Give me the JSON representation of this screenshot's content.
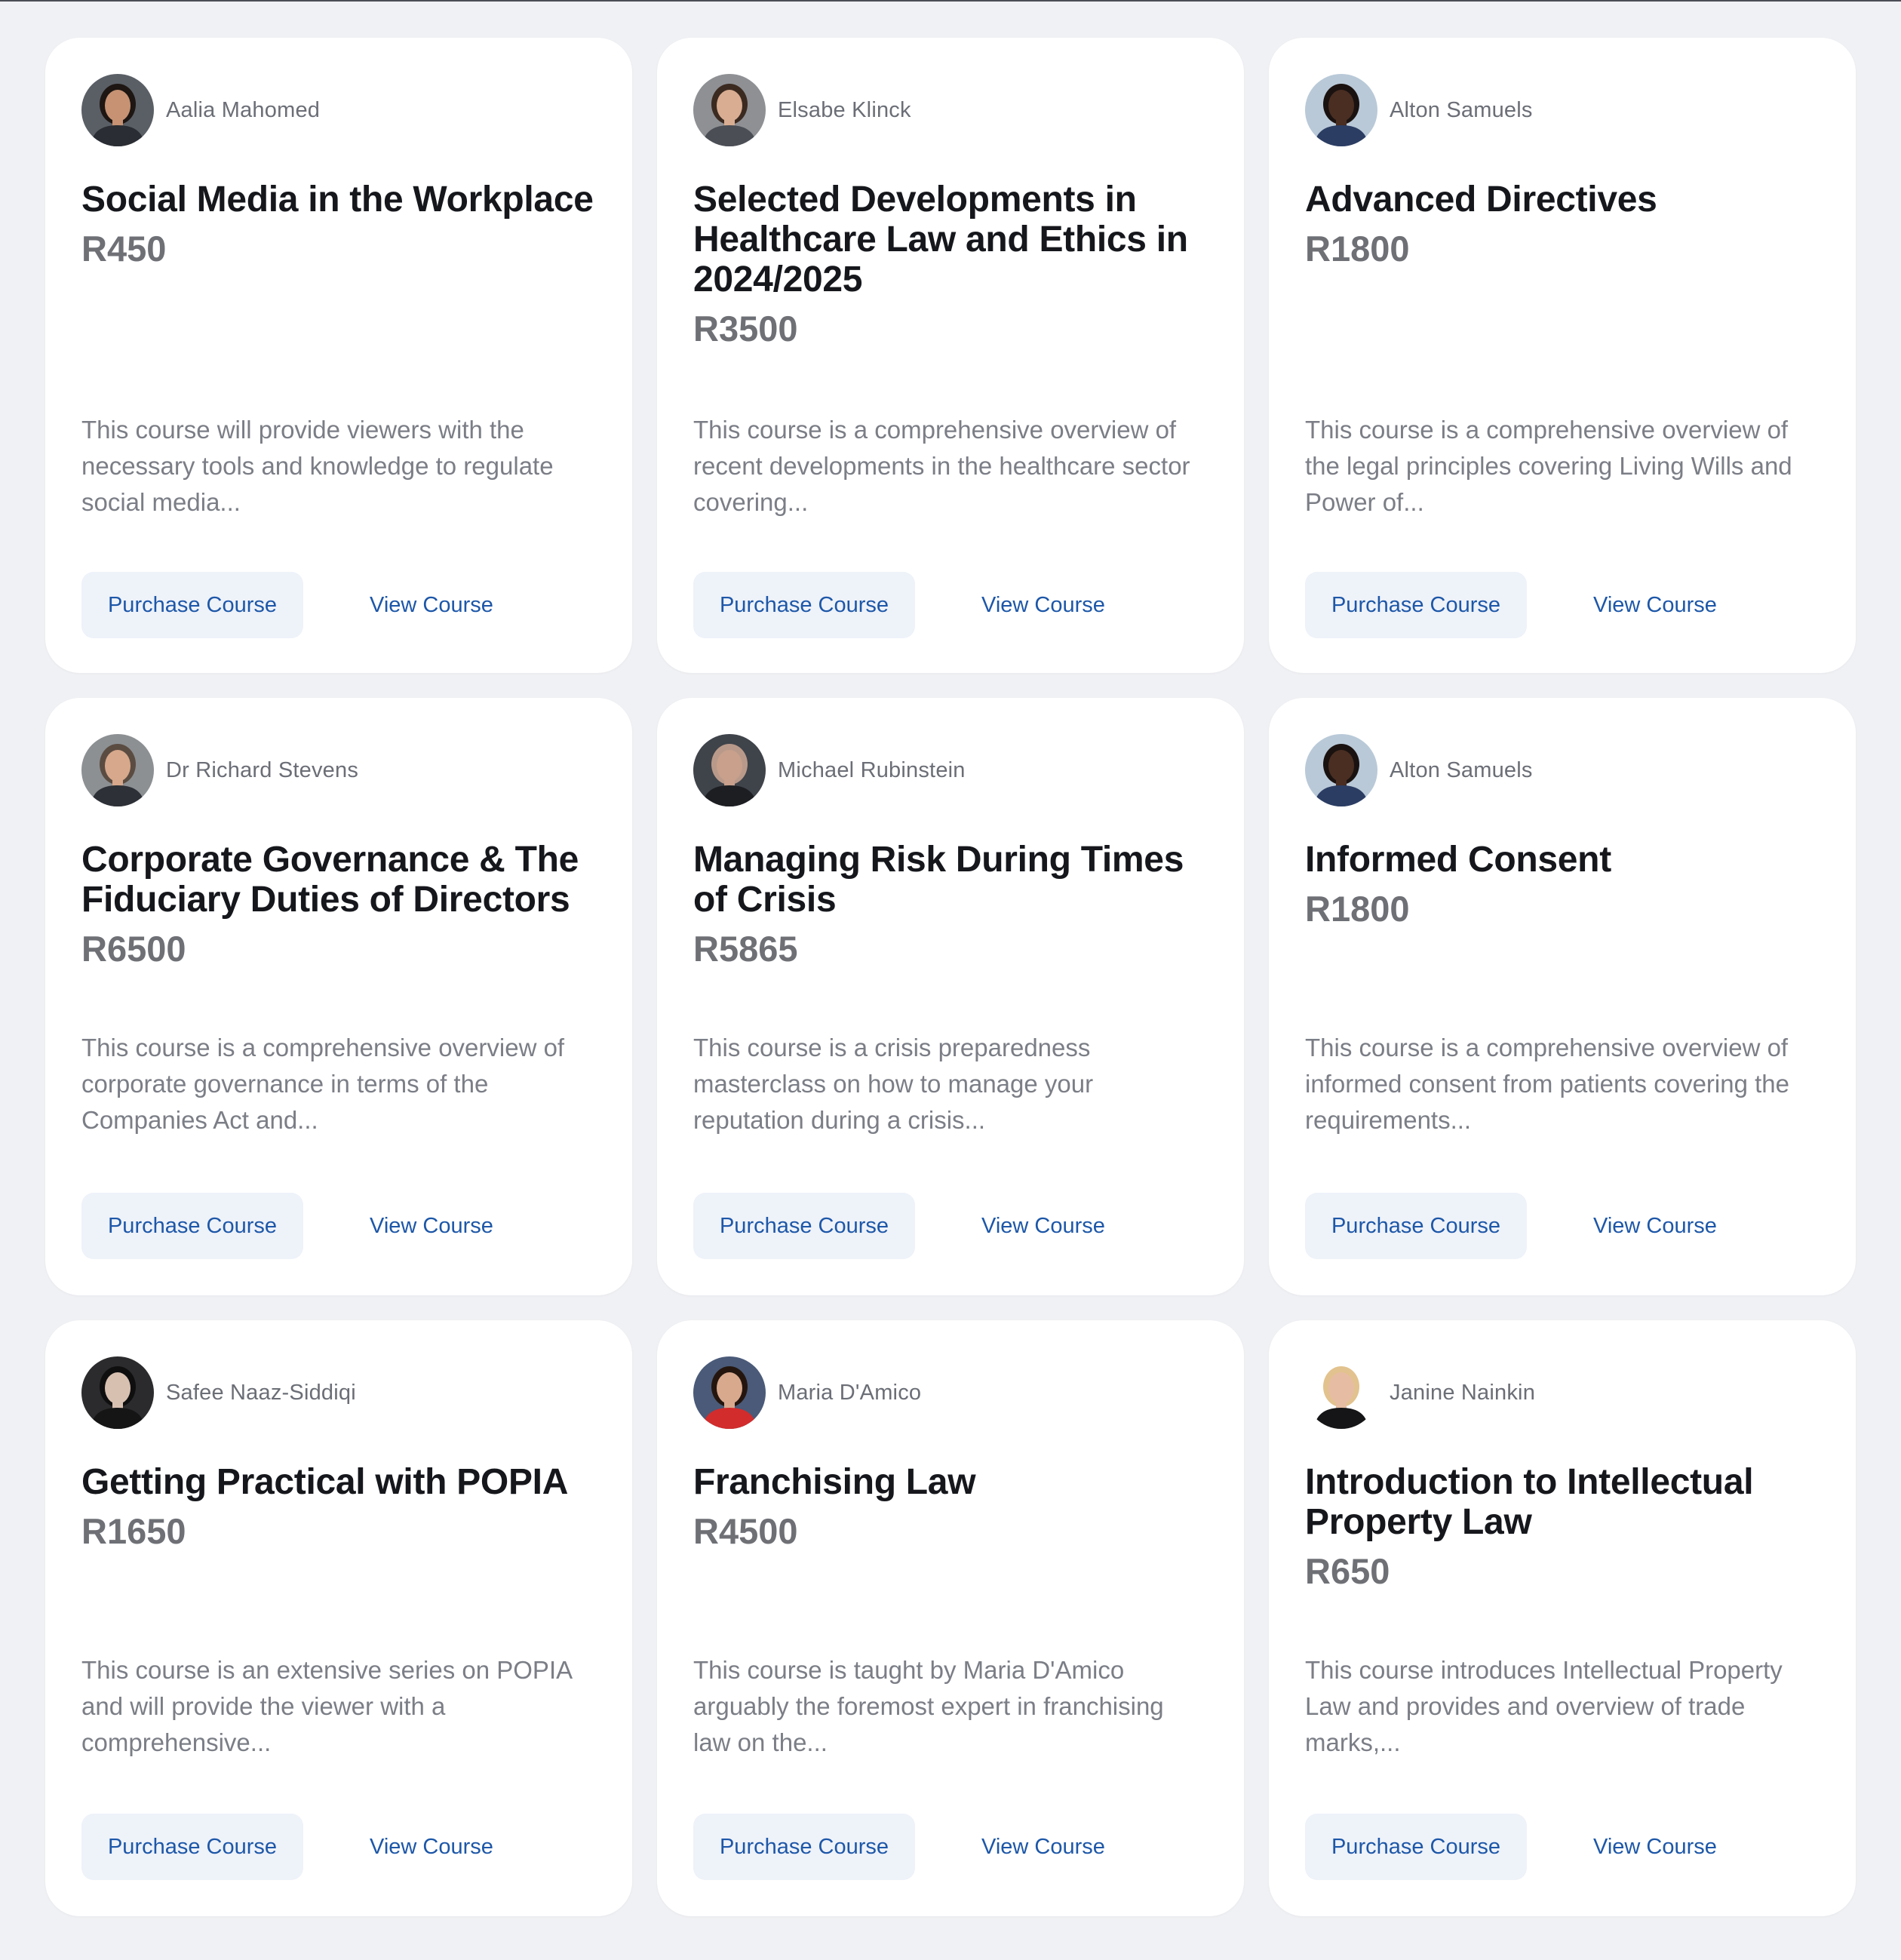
{
  "courses": [
    {
      "instructor": "Aalia Mahomed",
      "title": "Social Media in the Workplace",
      "price": "R450",
      "description": "This course will provide viewers with the necessary tools and knowledge to regulate social media...",
      "purchase_label": "Purchase Course",
      "view_label": "View Course",
      "avatar_icon": "person-portrait-icon",
      "avatar_colors": {
        "bg": "#5a5f66",
        "skin": "#c69273",
        "hair": "#1d1612",
        "clothes": "#2a2d33"
      }
    },
    {
      "instructor": "Elsabe Klinck",
      "title": "Selected Developments in Healthcare Law and Ethics in 2024/2025",
      "price": "R3500",
      "description": "This course is a comprehensive overview of recent developments in the healthcare sector covering...",
      "purchase_label": "Purchase Course",
      "view_label": "View Course",
      "avatar_icon": "person-portrait-icon",
      "avatar_colors": {
        "bg": "#8e9094",
        "skin": "#d9ad92",
        "hair": "#3b2a20",
        "clothes": "#4b4e55"
      }
    },
    {
      "instructor": "Alton Samuels",
      "title": "Advanced Directives",
      "price": "R1800",
      "description": "This course is a comprehensive overview of the legal principles covering Living Wills and Power of...",
      "purchase_label": "Purchase Course",
      "view_label": "View Course",
      "avatar_icon": "person-portrait-icon",
      "avatar_colors": {
        "bg": "#b9c9d8",
        "skin": "#4a2e22",
        "hair": "#1a1210",
        "clothes": "#2b3d63"
      }
    },
    {
      "instructor": "Dr Richard Stevens",
      "title": "Corporate Governance & The Fiduciary Duties of Directors",
      "price": "R6500",
      "description": "This course is a comprehensive overview of corporate governance in terms of the Companies Act and...",
      "purchase_label": "Purchase Course",
      "view_label": "View Course",
      "avatar_icon": "person-portrait-icon",
      "avatar_colors": {
        "bg": "#8c9093",
        "skin": "#d7a88b",
        "hair": "#5b4c42",
        "clothes": "#2d3036"
      }
    },
    {
      "instructor": "Michael Rubinstein",
      "title": "Managing Risk During Times of Crisis",
      "price": "R5865",
      "description": "This course is a crisis preparedness masterclass on how to manage your reputation during a crisis...",
      "purchase_label": "Purchase Course",
      "view_label": "View Course",
      "avatar_icon": "person-portrait-icon",
      "avatar_colors": {
        "bg": "#3f434a",
        "skin": "#c8a08c",
        "hair": "#b99a8a",
        "clothes": "#1c1e22"
      }
    },
    {
      "instructor": "Alton Samuels",
      "title": "Informed Consent",
      "price": "R1800",
      "description": "This course is a comprehensive overview of informed consent from patients covering the requirements...",
      "purchase_label": "Purchase Course",
      "view_label": "View Course",
      "avatar_icon": "person-portrait-icon",
      "avatar_colors": {
        "bg": "#b9c9d8",
        "skin": "#4a2e22",
        "hair": "#1a1210",
        "clothes": "#2b3d63"
      }
    },
    {
      "instructor": "Safee Naaz-Siddiqi",
      "title": "Getting Practical with POPIA",
      "price": "R1650",
      "description": "This course is an extensive series on POPIA and will provide the viewer with a comprehensive...",
      "purchase_label": "Purchase Course",
      "view_label": "View Course",
      "avatar_icon": "person-portrait-icon",
      "avatar_colors": {
        "bg": "#2b2b2d",
        "skin": "#d8c0b0",
        "hair": "#0f0f10",
        "clothes": "#151516"
      }
    },
    {
      "instructor": "Maria D'Amico",
      "title": "Franchising Law",
      "price": "R4500",
      "description": "This course is taught by Maria D'Amico arguably the foremost expert in franchising law on the...",
      "purchase_label": "Purchase Course",
      "view_label": "View Course",
      "avatar_icon": "person-portrait-icon",
      "avatar_colors": {
        "bg": "#4a5a78",
        "skin": "#d9a98d",
        "hair": "#24160f",
        "clothes": "#d22c2c"
      }
    },
    {
      "instructor": "Janine Nainkin",
      "title": "Introduction to Intellectual Property Law",
      "price": "R650",
      "description": "This course introduces Intellectual Property Law and provides and overview of trade marks,...",
      "purchase_label": "Purchase Course",
      "view_label": "View Course",
      "avatar_icon": "person-portrait-icon",
      "avatar_colors": {
        "bg": "#ffffff",
        "skin": "#e6bda3",
        "hair": "#e2c28e",
        "clothes": "#151517"
      }
    }
  ]
}
